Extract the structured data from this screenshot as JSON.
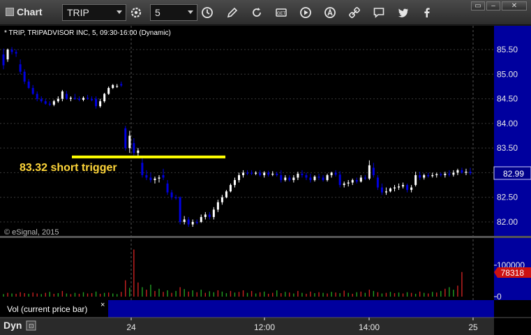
{
  "toolbar": {
    "app_title": "Chart",
    "symbol_value": "TRIP",
    "interval_value": "5",
    "window_buttons": [
      "▭",
      "–",
      "✕"
    ]
  },
  "chart": {
    "header": "* TRIP, TRIPADVISOR INC, 5, 09:30-16:00 (Dynamic)",
    "copyright": "© eSignal, 2015",
    "annotation_text": "83.32 short trigger",
    "annotation_level": 83.32,
    "last_price_label": "82.99",
    "last_volume_label": "78318",
    "volume_study_label": "Vol (current price bar)",
    "volume_study_close": "×",
    "dyn_label": "Dyn",
    "colors": {
      "up": "#ffffff",
      "down": "#0000e0",
      "vol_up": "#22a022",
      "vol_down": "#cc2222",
      "axis_bg": "#00009e",
      "annotation": "#ffff00"
    }
  },
  "chart_data": {
    "type": "candlestick",
    "price_axis": {
      "ticks": [
        "85.50",
        "85.00",
        "84.50",
        "84.00",
        "83.50",
        "83.00",
        "82.50",
        "82.00"
      ],
      "ylim": [
        81.8,
        85.9
      ]
    },
    "volume_axis": {
      "ticks": [
        "100000",
        "0"
      ],
      "ylim": [
        0,
        160000
      ]
    },
    "time_labels": [
      "24",
      "12:00",
      "14:00",
      "25"
    ],
    "candles": [
      [
        85.4,
        85.52,
        85.1,
        85.18
      ],
      [
        85.3,
        85.52,
        85.25,
        85.5
      ],
      [
        85.5,
        85.55,
        85.4,
        85.45
      ],
      [
        85.45,
        85.5,
        85.35,
        85.42
      ],
      [
        85.2,
        85.3,
        85.0,
        85.05
      ],
      [
        85.05,
        85.1,
        84.8,
        84.85
      ],
      [
        84.85,
        84.9,
        84.7,
        84.72
      ],
      [
        84.72,
        84.78,
        84.58,
        84.6
      ],
      [
        84.6,
        84.65,
        84.45,
        84.5
      ],
      [
        84.5,
        84.55,
        84.42,
        84.45
      ],
      [
        84.45,
        84.5,
        84.38,
        84.4
      ],
      [
        84.4,
        84.45,
        84.35,
        84.38
      ],
      [
        84.38,
        84.48,
        84.35,
        84.45
      ],
      [
        84.45,
        84.55,
        84.42,
        84.5
      ],
      [
        84.5,
        84.68,
        84.45,
        84.65
      ],
      [
        84.6,
        84.66,
        84.48,
        84.5
      ],
      [
        84.5,
        84.55,
        84.45,
        84.52
      ],
      [
        84.52,
        84.6,
        84.48,
        84.5
      ],
      [
        84.5,
        84.55,
        84.45,
        84.48
      ],
      [
        84.48,
        84.55,
        84.45,
        84.52
      ],
      [
        84.52,
        84.58,
        84.48,
        84.5
      ],
      [
        84.5,
        84.55,
        84.45,
        84.47
      ],
      [
        84.5,
        84.55,
        84.3,
        84.35
      ],
      [
        84.35,
        84.5,
        84.32,
        84.45
      ],
      [
        84.45,
        84.62,
        84.42,
        84.6
      ],
      [
        84.6,
        84.75,
        84.58,
        84.72
      ],
      [
        84.72,
        84.8,
        84.7,
        84.78
      ],
      [
        84.75,
        84.8,
        84.72,
        84.76
      ],
      [
        84.8,
        84.85,
        84.74,
        84.77
      ],
      [
        83.9,
        83.95,
        83.45,
        83.5
      ],
      [
        83.5,
        83.85,
        83.4,
        83.75
      ],
      [
        83.6,
        83.7,
        83.35,
        83.4
      ],
      [
        83.4,
        83.5,
        83.3,
        83.45
      ],
      [
        83.2,
        83.3,
        82.9,
        82.95
      ],
      [
        82.95,
        83.05,
        82.85,
        82.9
      ],
      [
        82.9,
        83.0,
        82.8,
        82.85
      ],
      [
        82.85,
        82.92,
        82.78,
        82.88
      ],
      [
        82.88,
        82.95,
        82.8,
        82.9
      ],
      [
        82.95,
        83.08,
        82.85,
        82.9
      ],
      [
        82.78,
        82.85,
        82.55,
        82.6
      ],
      [
        82.6,
        82.65,
        82.45,
        82.5
      ],
      [
        82.5,
        82.55,
        82.45,
        82.48
      ],
      [
        82.5,
        82.52,
        81.95,
        82.0
      ],
      [
        82.0,
        82.12,
        81.95,
        82.05
      ],
      [
        82.05,
        82.1,
        81.9,
        81.95
      ],
      [
        81.95,
        82.05,
        81.9,
        82.0
      ],
      [
        82.0,
        82.05,
        81.95,
        81.98
      ],
      [
        82.0,
        82.15,
        81.98,
        82.1
      ],
      [
        82.1,
        82.2,
        82.05,
        82.15
      ],
      [
        82.15,
        82.2,
        82.05,
        82.1
      ],
      [
        82.1,
        82.3,
        82.05,
        82.25
      ],
      [
        82.25,
        82.45,
        82.2,
        82.4
      ],
      [
        82.4,
        82.55,
        82.35,
        82.5
      ],
      [
        82.5,
        82.65,
        82.48,
        82.62
      ],
      [
        82.62,
        82.78,
        82.6,
        82.75
      ],
      [
        82.75,
        82.9,
        82.7,
        82.85
      ],
      [
        82.85,
        83.0,
        82.8,
        82.95
      ],
      [
        82.95,
        83.05,
        82.9,
        83.0
      ],
      [
        83.0,
        83.05,
        82.95,
        82.98
      ],
      [
        83.0,
        83.05,
        82.95,
        82.98
      ],
      [
        82.98,
        83.03,
        82.95,
        83.0
      ],
      [
        83.0,
        83.05,
        82.92,
        82.95
      ],
      [
        82.95,
        83.03,
        82.9,
        83.0
      ],
      [
        83.0,
        83.04,
        82.92,
        82.96
      ],
      [
        82.96,
        83.03,
        82.93,
        82.98
      ],
      [
        82.98,
        83.02,
        82.92,
        82.95
      ],
      [
        82.95,
        83.05,
        82.8,
        82.85
      ],
      [
        82.85,
        82.95,
        82.82,
        82.9
      ],
      [
        82.9,
        82.95,
        82.82,
        82.85
      ],
      [
        82.85,
        82.95,
        82.8,
        82.9
      ],
      [
        82.9,
        83.02,
        82.85,
        82.98
      ],
      [
        82.98,
        83.05,
        82.9,
        82.95
      ],
      [
        82.95,
        83.0,
        82.85,
        82.9
      ],
      [
        82.9,
        82.98,
        82.8,
        82.85
      ],
      [
        82.85,
        82.95,
        82.82,
        82.92
      ],
      [
        82.92,
        82.98,
        82.85,
        82.9
      ],
      [
        82.9,
        82.95,
        82.82,
        82.85
      ],
      [
        82.85,
        82.98,
        82.82,
        82.95
      ],
      [
        82.95,
        83.02,
        82.9,
        83.0
      ],
      [
        83.0,
        83.05,
        82.92,
        82.96
      ],
      [
        82.96,
        83.03,
        82.7,
        82.75
      ],
      [
        82.75,
        82.82,
        82.7,
        82.78
      ],
      [
        82.78,
        82.85,
        82.72,
        82.8
      ],
      [
        82.8,
        82.88,
        82.75,
        82.85
      ],
      [
        82.85,
        82.9,
        82.78,
        82.82
      ],
      [
        82.82,
        82.95,
        82.8,
        82.9
      ],
      [
        82.9,
        82.95,
        82.85,
        82.88
      ],
      [
        82.88,
        83.25,
        82.85,
        83.15
      ],
      [
        83.1,
        83.2,
        82.9,
        82.95
      ],
      [
        82.9,
        82.95,
        82.65,
        82.7
      ],
      [
        82.7,
        82.78,
        82.55,
        82.6
      ],
      [
        82.6,
        82.7,
        82.55,
        82.62
      ],
      [
        82.62,
        82.7,
        82.6,
        82.68
      ],
      [
        82.68,
        82.75,
        82.62,
        82.7
      ],
      [
        82.7,
        82.78,
        82.65,
        82.72
      ],
      [
        82.72,
        82.8,
        82.68,
        82.75
      ],
      [
        82.75,
        82.78,
        82.6,
        82.65
      ],
      [
        82.65,
        82.75,
        82.6,
        82.7
      ],
      [
        82.75,
        83.02,
        82.72,
        82.95
      ],
      [
        82.95,
        83.02,
        82.85,
        82.9
      ],
      [
        82.9,
        82.98,
        82.86,
        82.95
      ],
      [
        82.95,
        83.0,
        82.9,
        82.93
      ],
      [
        82.93,
        83.0,
        82.9,
        82.95
      ],
      [
        82.95,
        83.0,
        82.9,
        82.97
      ],
      [
        82.97,
        83.0,
        82.92,
        82.95
      ],
      [
        82.95,
        83.02,
        82.9,
        82.98
      ],
      [
        82.98,
        83.05,
        82.92,
        82.96
      ],
      [
        82.96,
        83.05,
        82.92,
        83.0
      ],
      [
        83.0,
        83.08,
        82.95,
        83.05
      ],
      [
        83.05,
        83.1,
        82.98,
        83.0
      ],
      [
        83.0,
        83.08,
        82.95,
        83.02
      ],
      [
        83.02,
        83.1,
        82.95,
        82.99
      ]
    ],
    "volumes": [
      [
        8000,
        1
      ],
      [
        12000,
        0
      ],
      [
        10000,
        1
      ],
      [
        9000,
        0
      ],
      [
        14000,
        0
      ],
      [
        11000,
        0
      ],
      [
        9000,
        1
      ],
      [
        13000,
        0
      ],
      [
        10000,
        0
      ],
      [
        8000,
        1
      ],
      [
        12000,
        0
      ],
      [
        15000,
        1
      ],
      [
        9000,
        0
      ],
      [
        11000,
        1
      ],
      [
        18000,
        0
      ],
      [
        10000,
        1
      ],
      [
        8000,
        0
      ],
      [
        12000,
        1
      ],
      [
        9000,
        0
      ],
      [
        14000,
        1
      ],
      [
        10000,
        0
      ],
      [
        11000,
        0
      ],
      [
        16000,
        1
      ],
      [
        9000,
        0
      ],
      [
        12000,
        1
      ],
      [
        13000,
        0
      ],
      [
        10000,
        1
      ],
      [
        8000,
        1
      ],
      [
        15000,
        0
      ],
      [
        52000,
        0
      ],
      [
        28000,
        1
      ],
      [
        150000,
        0
      ],
      [
        45000,
        0
      ],
      [
        30000,
        1
      ],
      [
        22000,
        0
      ],
      [
        38000,
        1
      ],
      [
        18000,
        0
      ],
      [
        25000,
        1
      ],
      [
        15000,
        0
      ],
      [
        20000,
        1
      ],
      [
        12000,
        0
      ],
      [
        18000,
        1
      ],
      [
        30000,
        0
      ],
      [
        24000,
        1
      ],
      [
        16000,
        0
      ],
      [
        20000,
        1
      ],
      [
        14000,
        0
      ],
      [
        22000,
        1
      ],
      [
        12000,
        0
      ],
      [
        17000,
        1
      ],
      [
        14000,
        1
      ],
      [
        20000,
        0
      ],
      [
        16000,
        1
      ],
      [
        11000,
        1
      ],
      [
        18000,
        0
      ],
      [
        13000,
        1
      ],
      [
        15000,
        0
      ],
      [
        20000,
        0
      ],
      [
        12000,
        1
      ],
      [
        18000,
        0
      ],
      [
        10000,
        1
      ],
      [
        14000,
        0
      ],
      [
        16000,
        1
      ],
      [
        9000,
        0
      ],
      [
        12000,
        0
      ],
      [
        20000,
        1
      ],
      [
        11000,
        0
      ],
      [
        15000,
        1
      ],
      [
        13000,
        0
      ],
      [
        10000,
        1
      ],
      [
        18000,
        0
      ],
      [
        12000,
        1
      ],
      [
        9000,
        0
      ],
      [
        16000,
        0
      ],
      [
        11000,
        1
      ],
      [
        14000,
        0
      ],
      [
        12000,
        1
      ],
      [
        10000,
        0
      ],
      [
        15000,
        1
      ],
      [
        13000,
        0
      ],
      [
        11000,
        1
      ],
      [
        19000,
        0
      ],
      [
        12000,
        1
      ],
      [
        9000,
        0
      ],
      [
        14000,
        1
      ],
      [
        16000,
        0
      ],
      [
        12000,
        1
      ],
      [
        22000,
        0
      ],
      [
        18000,
        1
      ],
      [
        14000,
        0
      ],
      [
        10000,
        1
      ],
      [
        12000,
        0
      ],
      [
        15000,
        1
      ],
      [
        11000,
        0
      ],
      [
        13000,
        1
      ],
      [
        10000,
        0
      ],
      [
        14000,
        1
      ],
      [
        12000,
        0
      ],
      [
        9000,
        1
      ],
      [
        16000,
        0
      ],
      [
        12000,
        1
      ],
      [
        10000,
        0
      ],
      [
        15000,
        1
      ],
      [
        13000,
        0
      ],
      [
        18000,
        1
      ],
      [
        25000,
        0
      ],
      [
        30000,
        1
      ],
      [
        22000,
        1
      ],
      [
        35000,
        0
      ],
      [
        78318,
        0
      ]
    ]
  }
}
